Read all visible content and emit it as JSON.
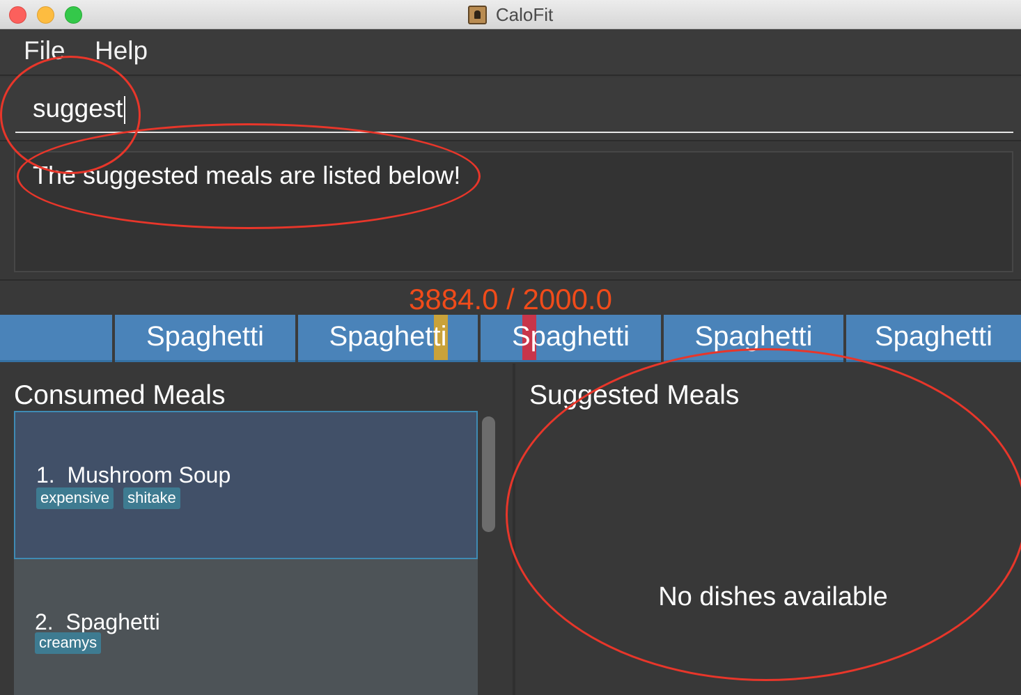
{
  "window": {
    "title": "CaloFit"
  },
  "menu": {
    "items": [
      "File",
      "Help"
    ]
  },
  "command": {
    "value": "suggest"
  },
  "result": {
    "message": "The suggested meals are listed below!"
  },
  "budget": {
    "text": "3884.0 / 2000.0",
    "color": "#f04b1a"
  },
  "trend": {
    "days": [
      {
        "label": "",
        "marker": null
      },
      {
        "label": "Spaghetti",
        "marker": null
      },
      {
        "label": "Spaghetti",
        "marker": "#c9a23a"
      },
      {
        "label": "Spaghetti",
        "marker": "#c8354a"
      },
      {
        "label": "Spaghetti",
        "marker": null
      },
      {
        "label": "Spaghetti",
        "marker": null
      }
    ]
  },
  "consumed": {
    "title": "Consumed Meals",
    "meals": [
      {
        "index": "1.",
        "name": "Mushroom Soup",
        "tags": [
          "expensive",
          "shitake"
        ]
      },
      {
        "index": "2.",
        "name": "Spaghetti",
        "tags": [
          "creamys"
        ]
      }
    ]
  },
  "suggested": {
    "title": "Suggested Meals",
    "empty_text": "No dishes available"
  },
  "colors": {
    "accent_blue": "#4a83b9",
    "tag_bg": "#3e7b91",
    "annotation_red": "#e8362a"
  }
}
